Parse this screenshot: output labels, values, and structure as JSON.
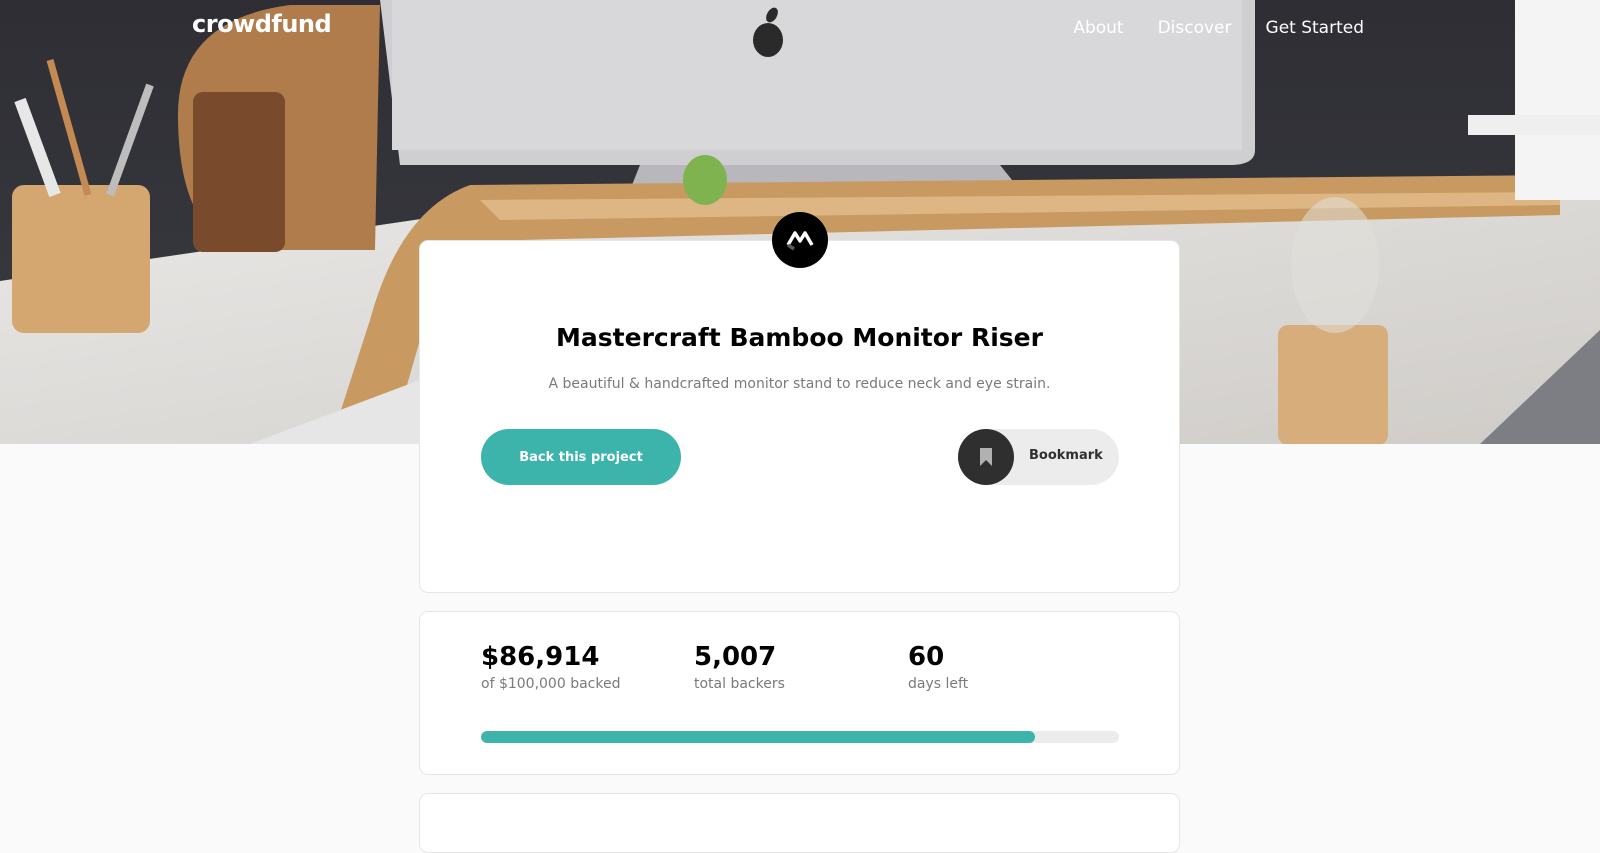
{
  "brand": "crowdfund",
  "nav": {
    "items": [
      "About",
      "Discover",
      "Get Started"
    ]
  },
  "project": {
    "title": "Mastercraft Bamboo Monitor Riser",
    "subtitle": "A beautiful & handcrafted monitor stand to reduce neck and eye strain.",
    "back_label": "Back this project",
    "bookmark_label": "Bookmark",
    "logo_icon": "mastercraft-logo-icon"
  },
  "stats": {
    "backed": {
      "value": "$86,914",
      "label": "of $100,000 backed"
    },
    "backers": {
      "value": "5,007",
      "label": "total backers"
    },
    "days": {
      "value": "60",
      "label": "days left"
    },
    "progress_fraction": 0.869
  },
  "colors": {
    "accent": "#3cb3ab",
    "dark": "#2f2f2f"
  }
}
